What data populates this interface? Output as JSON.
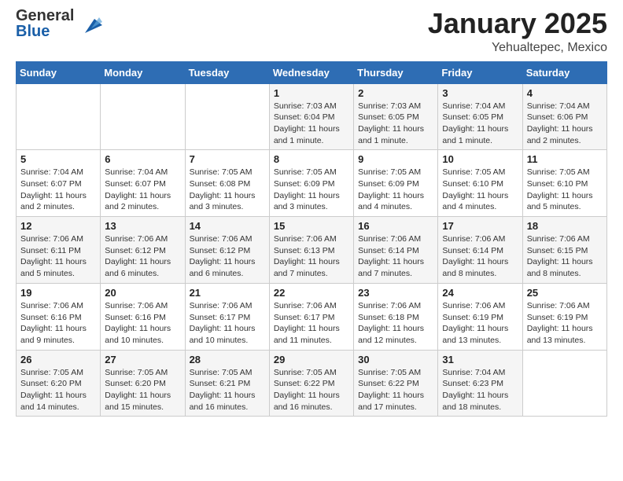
{
  "header": {
    "logo_line1": "General",
    "logo_line2": "Blue",
    "month": "January 2025",
    "location": "Yehualtepec, Mexico"
  },
  "weekdays": [
    "Sunday",
    "Monday",
    "Tuesday",
    "Wednesday",
    "Thursday",
    "Friday",
    "Saturday"
  ],
  "weeks": [
    [
      {
        "day": "",
        "info": ""
      },
      {
        "day": "",
        "info": ""
      },
      {
        "day": "",
        "info": ""
      },
      {
        "day": "1",
        "info": "Sunrise: 7:03 AM\nSunset: 6:04 PM\nDaylight: 11 hours and 1 minute."
      },
      {
        "day": "2",
        "info": "Sunrise: 7:03 AM\nSunset: 6:05 PM\nDaylight: 11 hours and 1 minute."
      },
      {
        "day": "3",
        "info": "Sunrise: 7:04 AM\nSunset: 6:05 PM\nDaylight: 11 hours and 1 minute."
      },
      {
        "day": "4",
        "info": "Sunrise: 7:04 AM\nSunset: 6:06 PM\nDaylight: 11 hours and 2 minutes."
      }
    ],
    [
      {
        "day": "5",
        "info": "Sunrise: 7:04 AM\nSunset: 6:07 PM\nDaylight: 11 hours and 2 minutes."
      },
      {
        "day": "6",
        "info": "Sunrise: 7:04 AM\nSunset: 6:07 PM\nDaylight: 11 hours and 2 minutes."
      },
      {
        "day": "7",
        "info": "Sunrise: 7:05 AM\nSunset: 6:08 PM\nDaylight: 11 hours and 3 minutes."
      },
      {
        "day": "8",
        "info": "Sunrise: 7:05 AM\nSunset: 6:09 PM\nDaylight: 11 hours and 3 minutes."
      },
      {
        "day": "9",
        "info": "Sunrise: 7:05 AM\nSunset: 6:09 PM\nDaylight: 11 hours and 4 minutes."
      },
      {
        "day": "10",
        "info": "Sunrise: 7:05 AM\nSunset: 6:10 PM\nDaylight: 11 hours and 4 minutes."
      },
      {
        "day": "11",
        "info": "Sunrise: 7:05 AM\nSunset: 6:10 PM\nDaylight: 11 hours and 5 minutes."
      }
    ],
    [
      {
        "day": "12",
        "info": "Sunrise: 7:06 AM\nSunset: 6:11 PM\nDaylight: 11 hours and 5 minutes."
      },
      {
        "day": "13",
        "info": "Sunrise: 7:06 AM\nSunset: 6:12 PM\nDaylight: 11 hours and 6 minutes."
      },
      {
        "day": "14",
        "info": "Sunrise: 7:06 AM\nSunset: 6:12 PM\nDaylight: 11 hours and 6 minutes."
      },
      {
        "day": "15",
        "info": "Sunrise: 7:06 AM\nSunset: 6:13 PM\nDaylight: 11 hours and 7 minutes."
      },
      {
        "day": "16",
        "info": "Sunrise: 7:06 AM\nSunset: 6:14 PM\nDaylight: 11 hours and 7 minutes."
      },
      {
        "day": "17",
        "info": "Sunrise: 7:06 AM\nSunset: 6:14 PM\nDaylight: 11 hours and 8 minutes."
      },
      {
        "day": "18",
        "info": "Sunrise: 7:06 AM\nSunset: 6:15 PM\nDaylight: 11 hours and 8 minutes."
      }
    ],
    [
      {
        "day": "19",
        "info": "Sunrise: 7:06 AM\nSunset: 6:16 PM\nDaylight: 11 hours and 9 minutes."
      },
      {
        "day": "20",
        "info": "Sunrise: 7:06 AM\nSunset: 6:16 PM\nDaylight: 11 hours and 10 minutes."
      },
      {
        "day": "21",
        "info": "Sunrise: 7:06 AM\nSunset: 6:17 PM\nDaylight: 11 hours and 10 minutes."
      },
      {
        "day": "22",
        "info": "Sunrise: 7:06 AM\nSunset: 6:17 PM\nDaylight: 11 hours and 11 minutes."
      },
      {
        "day": "23",
        "info": "Sunrise: 7:06 AM\nSunset: 6:18 PM\nDaylight: 11 hours and 12 minutes."
      },
      {
        "day": "24",
        "info": "Sunrise: 7:06 AM\nSunset: 6:19 PM\nDaylight: 11 hours and 13 minutes."
      },
      {
        "day": "25",
        "info": "Sunrise: 7:06 AM\nSunset: 6:19 PM\nDaylight: 11 hours and 13 minutes."
      }
    ],
    [
      {
        "day": "26",
        "info": "Sunrise: 7:05 AM\nSunset: 6:20 PM\nDaylight: 11 hours and 14 minutes."
      },
      {
        "day": "27",
        "info": "Sunrise: 7:05 AM\nSunset: 6:20 PM\nDaylight: 11 hours and 15 minutes."
      },
      {
        "day": "28",
        "info": "Sunrise: 7:05 AM\nSunset: 6:21 PM\nDaylight: 11 hours and 16 minutes."
      },
      {
        "day": "29",
        "info": "Sunrise: 7:05 AM\nSunset: 6:22 PM\nDaylight: 11 hours and 16 minutes."
      },
      {
        "day": "30",
        "info": "Sunrise: 7:05 AM\nSunset: 6:22 PM\nDaylight: 11 hours and 17 minutes."
      },
      {
        "day": "31",
        "info": "Sunrise: 7:04 AM\nSunset: 6:23 PM\nDaylight: 11 hours and 18 minutes."
      },
      {
        "day": "",
        "info": ""
      }
    ]
  ]
}
